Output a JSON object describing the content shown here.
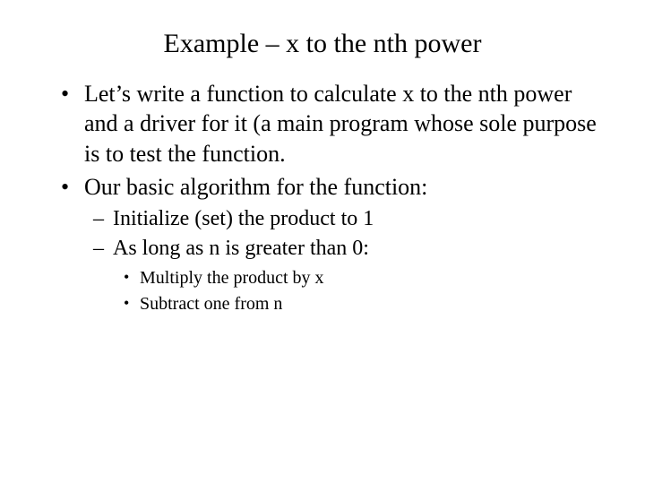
{
  "title": "Example – x to the nth power",
  "bullets": {
    "b1": "Let’s write a function to calculate x to the nth power and a driver for it (a main program whose sole purpose is to test the function.",
    "b2": "Our basic algorithm for the function:",
    "sub": {
      "s1": "Initialize (set) the product to 1",
      "s2": "As long as n is greater than 0:",
      "subsub": {
        "ss1": "Multiply the product by x",
        "ss2": "Subtract one from n"
      }
    }
  }
}
